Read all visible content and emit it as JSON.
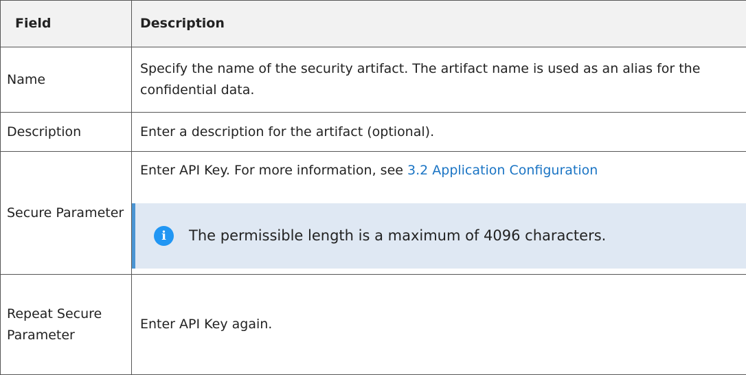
{
  "table": {
    "headers": {
      "field": "Field",
      "description": "Description"
    },
    "rows": [
      {
        "field": "Name",
        "description": "Specify the name of the security artifact. The artifact name is used as an alias for the confidential data."
      },
      {
        "field": "Description",
        "description": "Enter a description for the artifact (optional)."
      },
      {
        "field": "Secure Parameter",
        "description_prefix": "Enter API Key. For more information, see ",
        "link_text": "3.2 Application Configuration",
        "note": {
          "icon": "info-icon",
          "text": "The permissible length is a maximum of 4096 characters."
        }
      },
      {
        "field": "Repeat Secure Parameter",
        "description": "Enter API Key again."
      }
    ]
  },
  "colors": {
    "link": "#1a74c4",
    "note_background": "#dfe8f3",
    "note_border": "#4b95d3",
    "info_icon": "#2196f3",
    "header_background": "#f2f2f2"
  }
}
